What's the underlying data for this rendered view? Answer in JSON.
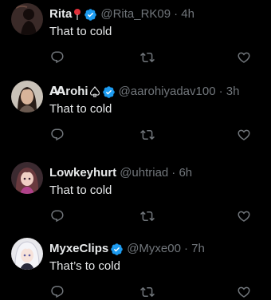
{
  "replies": [
    {
      "name": "Rita",
      "emoji": "pin",
      "handle": "@Rita_RK09",
      "time": "· 4h",
      "text": "That to cold",
      "avatar": "dark-silhouette-avatar"
    },
    {
      "name": "Ꜳrohi",
      "emoji": "spade-suit",
      "handle": "@aarohiyadav100",
      "time": "· 3h",
      "text": "That to cold",
      "avatar": "portrait-girl-avatar"
    },
    {
      "name": "Lowkeyhurt",
      "handle": "@uhtriad",
      "time": "· 6h",
      "text": "That to cold",
      "avatar": "anime-girl-avatar"
    },
    {
      "name": "MyxeClips",
      "handle": "@Myxe00",
      "time": "· 7h",
      "text": "That’s to cold",
      "avatar": "anime-white-hair-avatar"
    }
  ],
  "colors": {
    "background": "#000000",
    "text": "#e7e9ea",
    "muted": "#71767b",
    "verified": "#1d9bf0"
  }
}
